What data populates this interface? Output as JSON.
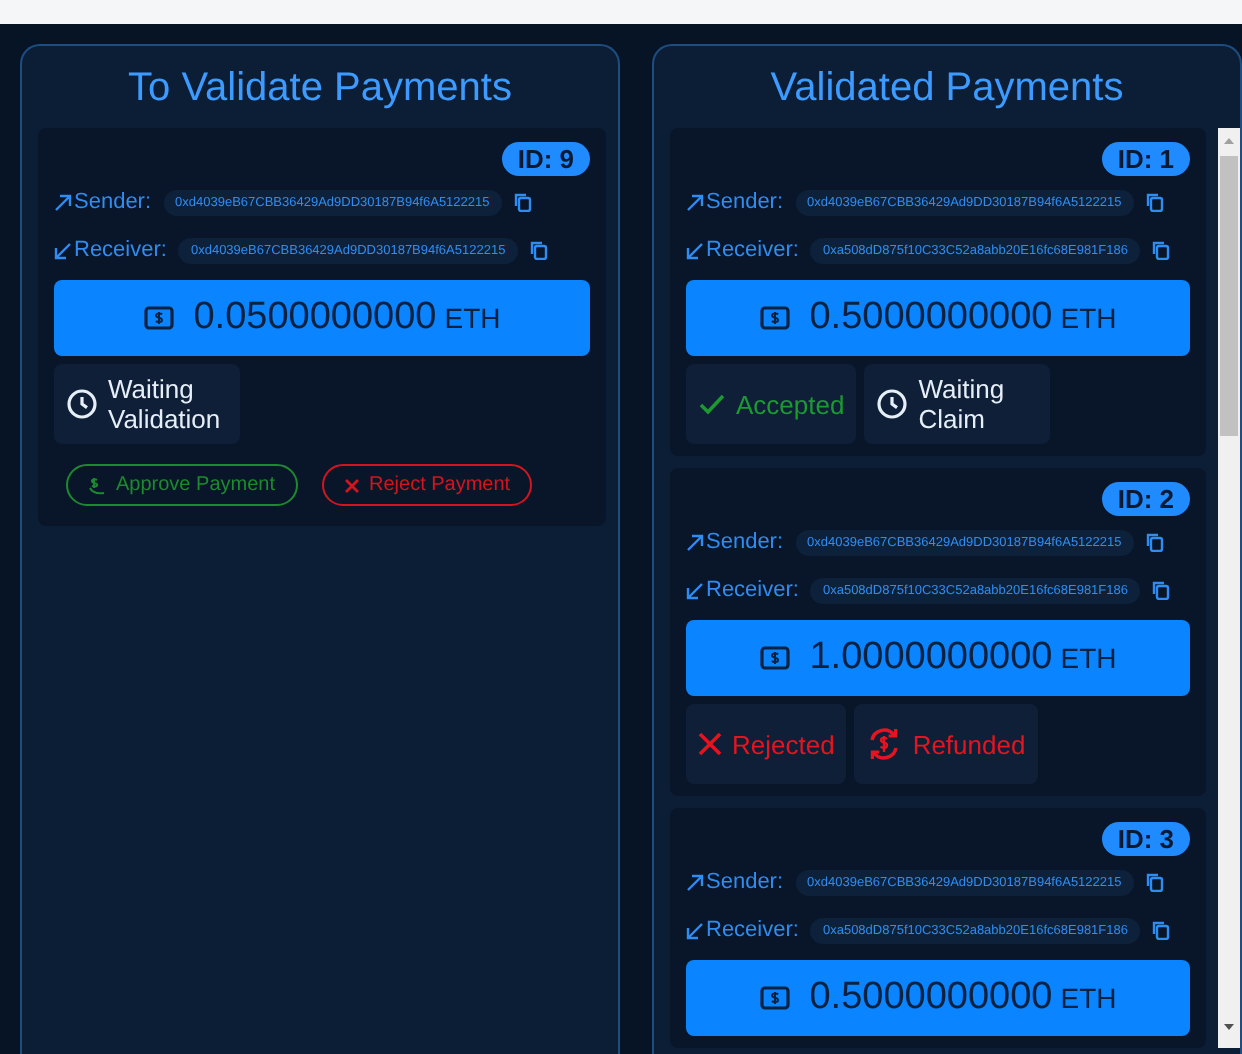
{
  "panels": [
    {
      "title": "To Validate Payments",
      "payments": [
        {
          "id": "ID: 9",
          "sender_label": "Sender:",
          "sender": "0xd4039eB67CBB36429Ad9DD30187B94f6A5122215",
          "receiver_label": "Receiver:",
          "receiver": "0xd4039eB67CBB36429Ad9DD30187B94f6A5122215",
          "amount": "0.0500000000",
          "unit": "ETH",
          "statuses": [
            {
              "kind": "waiting",
              "label": "Waiting Validation"
            }
          ],
          "actions": [
            {
              "kind": "approve",
              "label": "Approve Payment"
            },
            {
              "kind": "reject",
              "label": "Reject Payment"
            }
          ]
        }
      ]
    },
    {
      "title": "Validated Payments",
      "payments": [
        {
          "id": "ID: 1",
          "sender_label": "Sender:",
          "sender": "0xd4039eB67CBB36429Ad9DD30187B94f6A5122215",
          "receiver_label": "Receiver:",
          "receiver": "0xa508dD875f10C33C52a8abb20E16fc68E981F186",
          "amount": "0.5000000000",
          "unit": "ETH",
          "statuses": [
            {
              "kind": "accepted",
              "label": "Accepted"
            },
            {
              "kind": "waiting",
              "label": "Waiting Claim"
            }
          ]
        },
        {
          "id": "ID: 2",
          "sender_label": "Sender:",
          "sender": "0xd4039eB67CBB36429Ad9DD30187B94f6A5122215",
          "receiver_label": "Receiver:",
          "receiver": "0xa508dD875f10C33C52a8abb20E16fc68E981F186",
          "amount": "1.0000000000",
          "unit": "ETH",
          "statuses": [
            {
              "kind": "rejected",
              "label": "Rejected"
            },
            {
              "kind": "refunded",
              "label": "Refunded"
            }
          ]
        },
        {
          "id": "ID: 3",
          "sender_label": "Sender:",
          "sender": "0xd4039eB67CBB36429Ad9DD30187B94f6A5122215",
          "receiver_label": "Receiver:",
          "receiver": "0xa508dD875f10C33C52a8abb20E16fc68E981F186",
          "amount": "0.5000000000",
          "unit": "ETH"
        }
      ]
    }
  ]
}
